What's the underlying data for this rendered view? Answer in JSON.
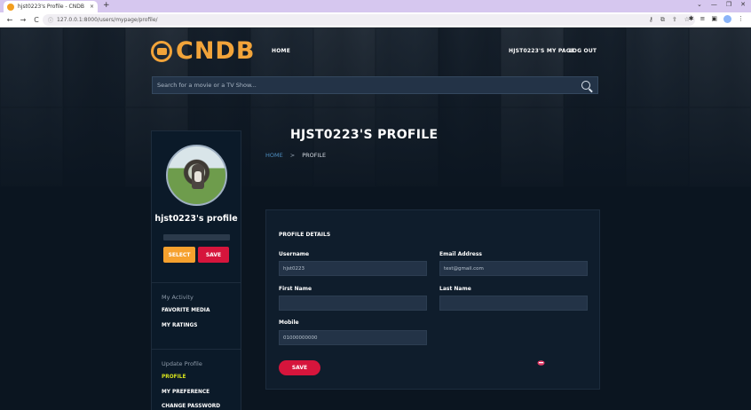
{
  "browser": {
    "tab_title": "hjst0223's Profile - CNDB",
    "tab_close": "×",
    "new_tab": "+",
    "url": "127.0.0.1:8000/users/mypage/profile/",
    "back": "←",
    "forward": "→",
    "reload": "C",
    "win_min": "⌄",
    "win_minimize": "—",
    "win_restore": "❐",
    "win_close": "✕"
  },
  "site": {
    "logo": "CNDB",
    "nav_home": "HOME",
    "nav_mypage": "HJST0223'S MY PAGE",
    "nav_logout": "LOG OUT",
    "search_placeholder": "Search for a movie or a TV Show..."
  },
  "header": {
    "title": "HJST0223'S PROFILE",
    "breadcrumb_home": "HOME",
    "breadcrumb_sep": ">",
    "breadcrumb_current": "PROFILE"
  },
  "sidebar": {
    "username": "hjst0223's profile",
    "select_label": "SELECT",
    "save_label": "SAVE",
    "activity_heading": "My Activity",
    "activity_links": [
      "FAVORITE MEDIA",
      "MY RATINGS"
    ],
    "update_heading": "Update Profile",
    "update_links": [
      "PROFILE",
      "MY PREFERENCE",
      "CHANGE PASSWORD"
    ]
  },
  "profile_form": {
    "title": "PROFILE DETAILS",
    "username_label": "Username",
    "username_value": "hjst0223",
    "email_label": "Email Address",
    "email_value": "test@gmail.com",
    "first_name_label": "First Name",
    "first_name_value": "",
    "last_name_label": "Last Name",
    "last_name_value": "",
    "mobile_label": "Mobile",
    "mobile_value": "01000000000",
    "save_label": "SAVE"
  },
  "colors": {
    "accent_orange": "#f2a43a",
    "accent_red": "#d6153c",
    "active_link": "#d6e11b",
    "background": "#0b1520"
  }
}
